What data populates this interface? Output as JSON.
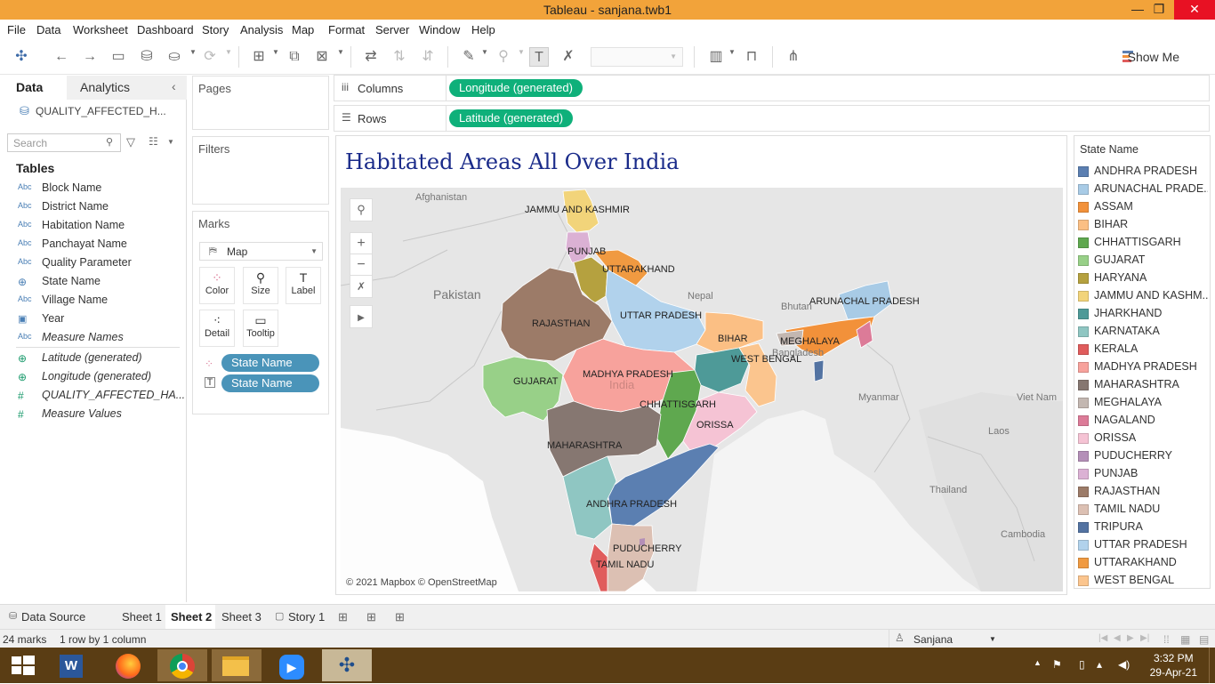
{
  "window": {
    "title": "Tableau - sanjana.twb1",
    "min": "—",
    "max": "❐",
    "close": "✕"
  },
  "menu": [
    "File",
    "Data",
    "Worksheet",
    "Dashboard",
    "Story",
    "Analysis",
    "Map",
    "Format",
    "Server",
    "Window",
    "Help"
  ],
  "toolbar": {
    "show_me": "Show Me"
  },
  "left": {
    "tab_data": "Data",
    "tab_analytics": "Analytics",
    "datasource": "QUALITY_AFFECTED_H...",
    "search_placeholder": "Search",
    "tables_header": "Tables",
    "fields": [
      {
        "type": "Abc",
        "name": "Block Name"
      },
      {
        "type": "Abc",
        "name": "District Name"
      },
      {
        "type": "Abc",
        "name": "Habitation Name"
      },
      {
        "type": "Abc",
        "name": "Panchayat Name"
      },
      {
        "type": "Abc",
        "name": "Quality Parameter"
      },
      {
        "type": "⊕",
        "name": "State Name"
      },
      {
        "type": "Abc",
        "name": "Village Name"
      },
      {
        "type": "▣",
        "name": "Year"
      },
      {
        "type": "Abc",
        "name": "Measure Names"
      },
      {
        "type": "⊕",
        "name": "Latitude (generated)"
      },
      {
        "type": "⊕",
        "name": "Longitude (generated)"
      },
      {
        "type": "#",
        "name": "QUALITY_AFFECTED_HA..."
      },
      {
        "type": "#",
        "name": "Measure Values"
      }
    ]
  },
  "shelves": {
    "pages": "Pages",
    "filters": "Filters",
    "marks": "Marks",
    "mark_type": "Map",
    "mark_buttons": [
      "Color",
      "Size",
      "Label",
      "Detail",
      "Tooltip"
    ],
    "mark_pills": [
      "State Name",
      "State Name"
    ],
    "columns_label": "Columns",
    "columns_pill": "Longitude (generated)",
    "rows_label": "Rows",
    "rows_pill": "Latitude (generated)"
  },
  "viz": {
    "title": "Habitated Areas All Over India",
    "attribution": "© 2021 Mapbox © OpenStreetMap",
    "country_labels": [
      "Afghanistan",
      "Pakistan",
      "Nepal",
      "Bhutan",
      "Bangladesh",
      "Myanmar",
      "Laos",
      "Thailand",
      "Viet Nam",
      "Cambodia",
      "India"
    ],
    "state_labels": [
      "JAMMU AND KASHMIR",
      "PUNJAB",
      "UTTARAKHAND",
      "RAJASTHAN",
      "UTTAR PRADESH",
      "ARUNACHAL PRADESH",
      "BIHAR",
      "MEGHALAYA",
      "WEST BENGAL",
      "GUJARAT",
      "MADHYA PRADESH",
      "CHHATTISGARH",
      "ORISSA",
      "MAHARASHTRA",
      "ANDHRA PRADESH",
      "PUDUCHERRY",
      "TAMIL NADU"
    ]
  },
  "legend": {
    "title": "State Name",
    "items": [
      {
        "name": "ANDHRA PRADESH",
        "color": "#5b7fb1"
      },
      {
        "name": "ARUNACHAL PRADE..",
        "color": "#a8cbe6"
      },
      {
        "name": "ASSAM",
        "color": "#f2913a"
      },
      {
        "name": "BIHAR",
        "color": "#fbbf84"
      },
      {
        "name": "CHHATTISGARH",
        "color": "#5fa84f"
      },
      {
        "name": "GUJARAT",
        "color": "#98d088"
      },
      {
        "name": "HARYANA",
        "color": "#b5a13f"
      },
      {
        "name": "JAMMU AND KASHM..",
        "color": "#f2d47a"
      },
      {
        "name": "JHARKHAND",
        "color": "#4e9a98"
      },
      {
        "name": "KARNATAKA",
        "color": "#8fc6c2"
      },
      {
        "name": "KERALA",
        "color": "#e05c5c"
      },
      {
        "name": "MADHYA PRADESH",
        "color": "#f7a29c"
      },
      {
        "name": "MAHARASHTRA",
        "color": "#867771"
      },
      {
        "name": "MEGHALAYA",
        "color": "#c3b7b1"
      },
      {
        "name": "NAGALAND",
        "color": "#dc7b98"
      },
      {
        "name": "ORISSA",
        "color": "#f5c3d4"
      },
      {
        "name": "PUDUCHERRY",
        "color": "#b48fb8"
      },
      {
        "name": "PUNJAB",
        "color": "#dbb1d4"
      },
      {
        "name": "RAJASTHAN",
        "color": "#9c7b68"
      },
      {
        "name": "TAMIL NADU",
        "color": "#dcc0b3"
      },
      {
        "name": "TRIPURA",
        "color": "#5373a2"
      },
      {
        "name": "UTTAR PRADESH",
        "color": "#b1d2ec"
      },
      {
        "name": "UTTARAKHAND",
        "color": "#f09a41"
      },
      {
        "name": "WEST BENGAL",
        "color": "#fbc58e"
      }
    ]
  },
  "sheets": {
    "datasource": "Data Source",
    "tabs": [
      "Sheet 1",
      "Sheet 2",
      "Sheet 3"
    ],
    "story": "Story 1",
    "active": "Sheet 2"
  },
  "status": {
    "marks": "24 marks",
    "rows": "1 row by 1 column",
    "user": "Sanjana"
  },
  "clock": {
    "time": "3:32 PM",
    "date": "29-Apr-21"
  }
}
